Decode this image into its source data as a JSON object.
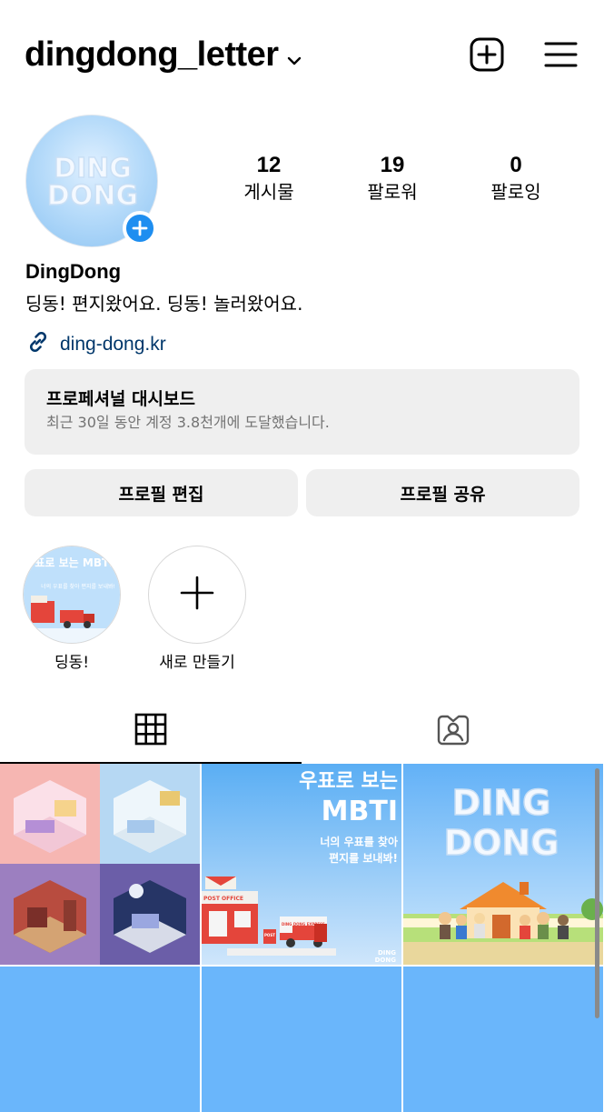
{
  "header": {
    "username": "dingdong_letter",
    "icons": [
      "chevron-down-icon",
      "add-post-icon",
      "menu-icon"
    ]
  },
  "profile": {
    "avatar_text": [
      "DING",
      "DONG"
    ],
    "stats": [
      {
        "value": "12",
        "label": "게시물"
      },
      {
        "value": "19",
        "label": "팔로워"
      },
      {
        "value": "0",
        "label": "팔로잉"
      }
    ],
    "display_name": "DingDong",
    "bio": "딩동! 편지왔어요. 딩동! 놀러왔어요.",
    "link": "ding-dong.kr"
  },
  "dashboard": {
    "title": "프로페셔널 대시보드",
    "subtitle": "최근 30일 동안 계정 3.8천개에 도달했습니다."
  },
  "buttons": {
    "edit_profile": "프로필 편집",
    "share_profile": "프로필 공유"
  },
  "highlights": [
    {
      "label": "딩동!",
      "cover_title": "우표로 보는 MBTI",
      "cover_sub": "너의 우표를 찾아 편지를 보내봐!"
    },
    {
      "label": "새로 만들기"
    }
  ],
  "tabs": [
    "grid-icon",
    "tagged-icon"
  ],
  "posts": {
    "mbti_title_1": "우표로 보는",
    "mbti_title_2": "MBTI",
    "mbti_sub_1": "너의 우표를 찾아",
    "mbti_sub_2": "편지를 보내봐!",
    "post_office": "POST OFFICE",
    "post": "POST",
    "truck_text": "DING DONG EXPRESS",
    "logo_text": [
      "DING",
      "DONG"
    ]
  },
  "colors": {
    "accent_blue": "#1e8ef0",
    "link": "#00376b",
    "sky": "#6ab6fb",
    "button_bg": "#efefef"
  }
}
